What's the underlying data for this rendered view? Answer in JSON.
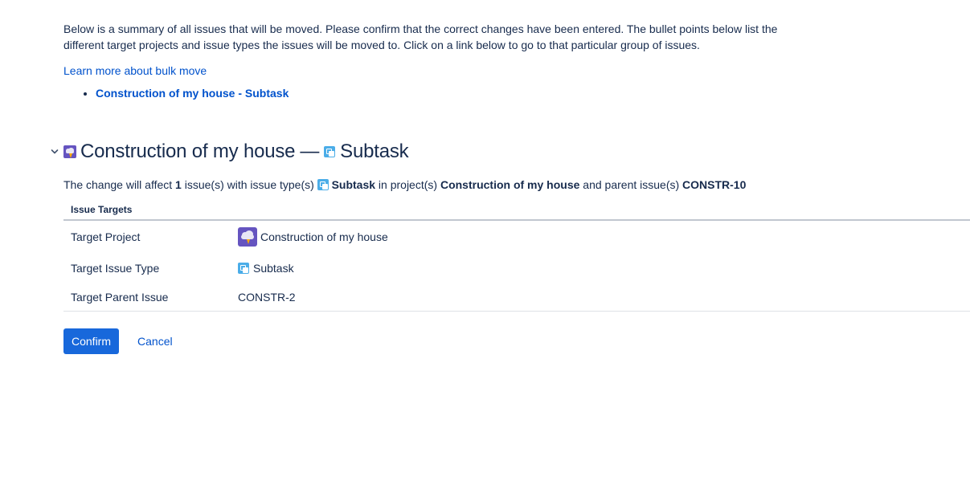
{
  "intro": {
    "text": "Below is a summary of all issues that will be moved. Please confirm that the correct changes have been entered. The bullet points below list the different target projects and issue types the issues will be moved to. Click on a link below to go to that particular group of issues."
  },
  "learn_more": {
    "label": "Learn more about bulk move"
  },
  "groups": [
    {
      "label": "Construction of my house - Subtask"
    }
  ],
  "section": {
    "project_name": "Construction of my house",
    "separator": "—",
    "issue_type": "Subtask",
    "project_icon": "project-avatar-icon",
    "issue_type_icon": "subtask-icon",
    "chevron_icon": "chevron-down-icon"
  },
  "summary": {
    "prefix": "The change will affect",
    "count": "1",
    "mid1": "issue(s) with issue type(s)",
    "issue_type": "Subtask",
    "mid2": "in project(s)",
    "project": "Construction of my house",
    "mid3": "and parent issue(s)",
    "parent": "CONSTR-10"
  },
  "targets": {
    "header": "Issue Targets",
    "rows": [
      {
        "label": "Target Project",
        "value": "Construction of my house"
      },
      {
        "label": "Target Issue Type",
        "value": "Subtask"
      },
      {
        "label": "Target Parent Issue",
        "value": "CONSTR-2"
      }
    ]
  },
  "actions": {
    "confirm_label": "Confirm",
    "cancel_label": "Cancel"
  },
  "colors": {
    "link": "#0052cc",
    "primary_button": "#1868db",
    "text": "#172b4d",
    "project_avatar": "#6554c0",
    "subtask_icon": "#4bade8"
  }
}
